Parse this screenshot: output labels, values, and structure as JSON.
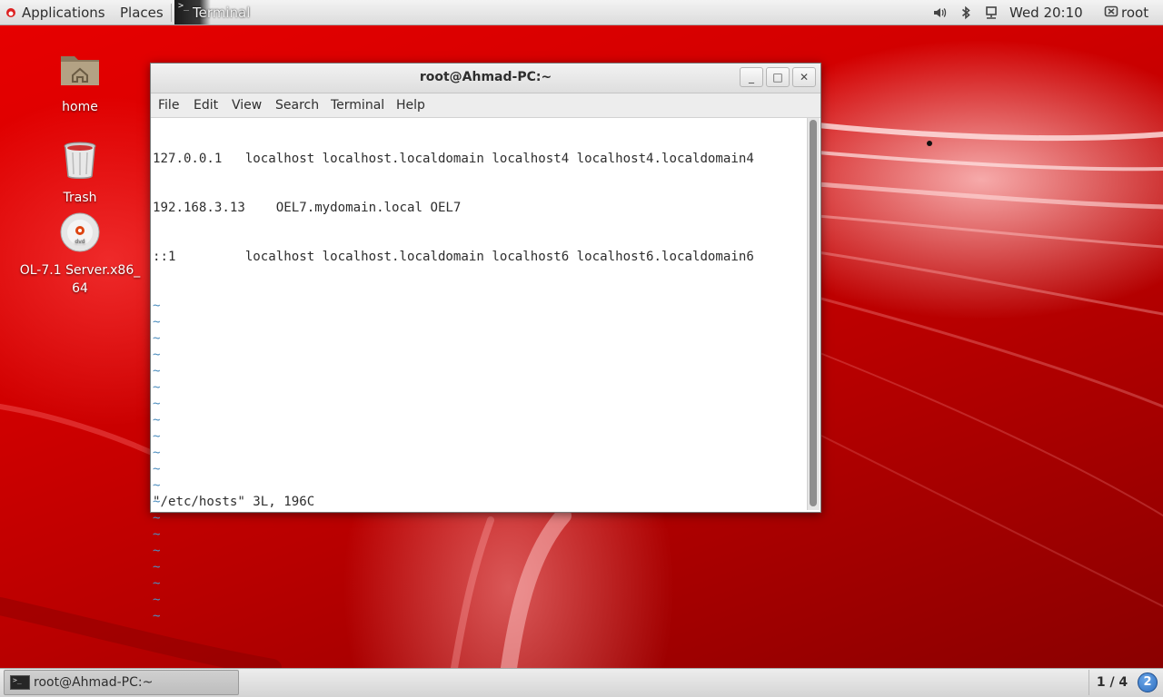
{
  "top_panel": {
    "applications": "Applications",
    "places": "Places",
    "active_task": "Terminal",
    "clock": "Wed 20:10",
    "user": "root",
    "icons": [
      "volume-icon",
      "bluetooth-icon",
      "network-icon",
      "user-icon"
    ]
  },
  "desktop": {
    "icons": [
      {
        "label": "home",
        "icon": "folder-home-icon"
      },
      {
        "label": "Trash",
        "icon": "trash-icon"
      },
      {
        "label": "OL-7.1 Server.x86_\n64",
        "icon": "optical-disc-icon"
      }
    ]
  },
  "terminal": {
    "title": "root@Ahmad-PC:~",
    "window_buttons": {
      "minimize": "_",
      "maximize": "□",
      "close": "✕"
    },
    "menu": [
      "File",
      "Edit",
      "View",
      "Search",
      "Terminal",
      "Help"
    ],
    "lines": [
      "127.0.0.1   localhost localhost.localdomain localhost4 localhost4.localdomain4",
      "192.168.3.13    OEL7.mydomain.local OEL7",
      "::1         localhost localhost.localdomain localhost6 localhost6.localdomain6"
    ],
    "tilde": "~",
    "tilde_count": 20,
    "status": "\"/etc/hosts\" 3L, 196C"
  },
  "bottom_panel": {
    "task": "root@Ahmad-PC:~",
    "workspace": "1 / 4",
    "notification_count": "2"
  },
  "colors": {
    "wallpaper": "#c40000",
    "tilde": "#4e8fbf",
    "badge": "#2f6fbf"
  }
}
